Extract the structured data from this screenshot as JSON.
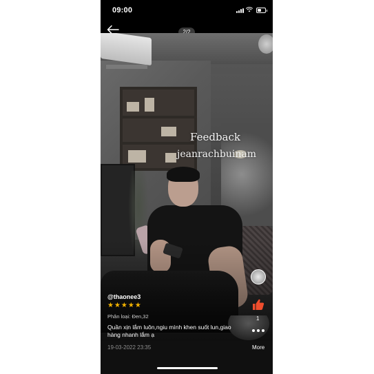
{
  "status_bar": {
    "time": "09:00"
  },
  "viewer": {
    "pager": "2/2"
  },
  "photo": {
    "title": "Feedback",
    "subtitle": "jeanrachbuinam"
  },
  "review": {
    "username": "@thaonee3",
    "rating_stars": 5,
    "stars_display": "★★★★★",
    "variant": "Phân loại: Đen,32",
    "comment": "Quần xịn lắm luôn,ngiu mình khen suốt lun,giao hàng nhanh lắm ạ",
    "date": "19-03-2022 23:35",
    "like_count": "1",
    "more_label": "More"
  },
  "colors": {
    "star": "#f5b400",
    "like": "#ee4d2d",
    "background": "#101010"
  },
  "icons": [
    "back-arrow-icon",
    "like-icon",
    "more-options-icon",
    "wifi-icon",
    "battery-icon",
    "signal-icon"
  ]
}
